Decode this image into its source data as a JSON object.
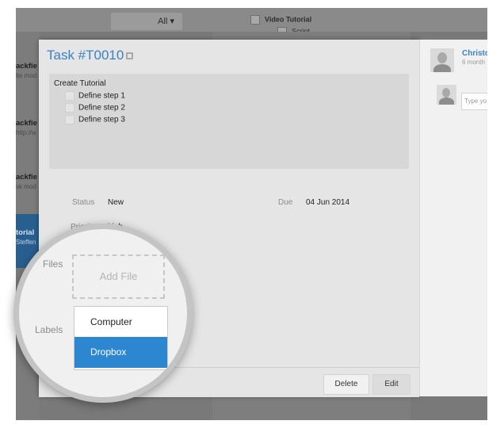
{
  "background": {
    "filter_select": "All",
    "filter_arrow": "▾",
    "checklist_items": [
      "Video Tutorial",
      "Script"
    ],
    "sidebar_items": [
      {
        "title": "ackfie",
        "sub": "ite mod"
      },
      {
        "title": "ackfie",
        "sub": "http://w"
      },
      {
        "title": "ackfie",
        "sub": "sk mod"
      },
      {
        "title": "torial",
        "sub": "Steffen"
      }
    ]
  },
  "modal": {
    "title": "Task #T0010",
    "description": {
      "title": "Create Tutorial",
      "steps": [
        "Define step 1",
        "Define step 2",
        "Define step 3"
      ]
    },
    "fields": {
      "status_label": "Status",
      "status_value": "New",
      "due_label": "Due",
      "due_value": "04 Jun 2014",
      "priority_label": "Priority",
      "priority_value": "high"
    },
    "footer": {
      "delete_label": "Delete",
      "edit_label": "Edit"
    }
  },
  "comments": {
    "author": "Christo",
    "time": "6 month",
    "input_placeholder": "Type yo"
  },
  "magnifier": {
    "files_label": "Files",
    "add_file_label": "Add File",
    "labels_label": "Labels",
    "label_options": [
      "Computer",
      "Dropbox"
    ],
    "selected_option": "Dropbox"
  },
  "colors": {
    "accent": "#3c82c2",
    "selected": "#2d86d0"
  }
}
